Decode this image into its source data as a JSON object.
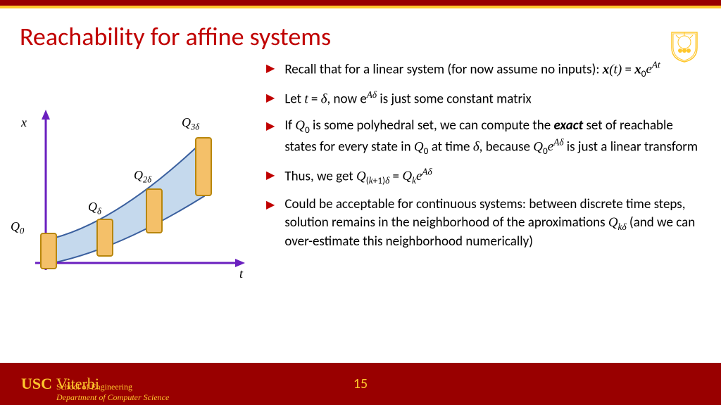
{
  "title": "Reachability for affine systems",
  "bullets": {
    "b1": "Recall that for a linear system (for now assume no inputs): 𝐱(𝑡) = 𝐱₀𝑒^{𝐴𝑡}",
    "b2": "Let 𝑡 = 𝛿, now e^{𝐴𝛿} is just some constant matrix",
    "b3": "If 𝑄₀ is some polyhedral set, we can compute the 𝒆𝒙𝒂𝒄𝒕 set of reachable states for every state in 𝑄₀ at time 𝛿, because 𝑄₀𝑒^{𝐴𝛿} is just a linear transform",
    "b4": "Thus, we get 𝑄_{(𝑘+1)𝛿} = 𝑄_{𝑘}𝑒^{𝐴𝛿}",
    "b5": "Could be acceptable for continuous systems: between discrete time steps, solution remains in the neighborhood of the aproximations 𝑄_{𝑘𝛿} (and we can over-estimate this neighborhood numerically)"
  },
  "figure": {
    "x_label": "𝑥",
    "t_label": "𝑡",
    "q0": "𝑄₀",
    "qd": "𝑄_𝛿",
    "q2d": "𝑄_{2𝛿}",
    "q3d": "𝑄_{3𝛿}"
  },
  "footer": {
    "usc": "USC",
    "viterbi": "Viterbi",
    "school": "School of Engineering",
    "dept": "Department of Computer Science",
    "page": "15"
  }
}
